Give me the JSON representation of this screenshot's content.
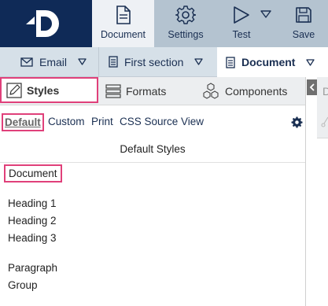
{
  "toolbar": {
    "document_label": "Document",
    "settings_label": "Settings",
    "test_label": "Test",
    "save_label": "Save"
  },
  "sections": {
    "email_label": "Email",
    "first_section_label": "First section",
    "document_label": "Document"
  },
  "tabs": {
    "styles": "Styles",
    "formats": "Formats",
    "components": "Components"
  },
  "subtabs": {
    "default": "Default",
    "custom": "Custom",
    "print": "Print",
    "css_source_view": "CSS Source View"
  },
  "panel": {
    "title": "Default Styles",
    "items": [
      "Document",
      "Heading 1",
      "Heading 2",
      "Heading 3",
      "Paragraph",
      "Group"
    ]
  },
  "right_panel": {
    "partial_letter": "D"
  },
  "colors": {
    "logo_bg": "#0f2a57",
    "toolbar_bg": "#b4c3d0",
    "highlight": "#e0407a",
    "accent": "#1a2f52"
  }
}
